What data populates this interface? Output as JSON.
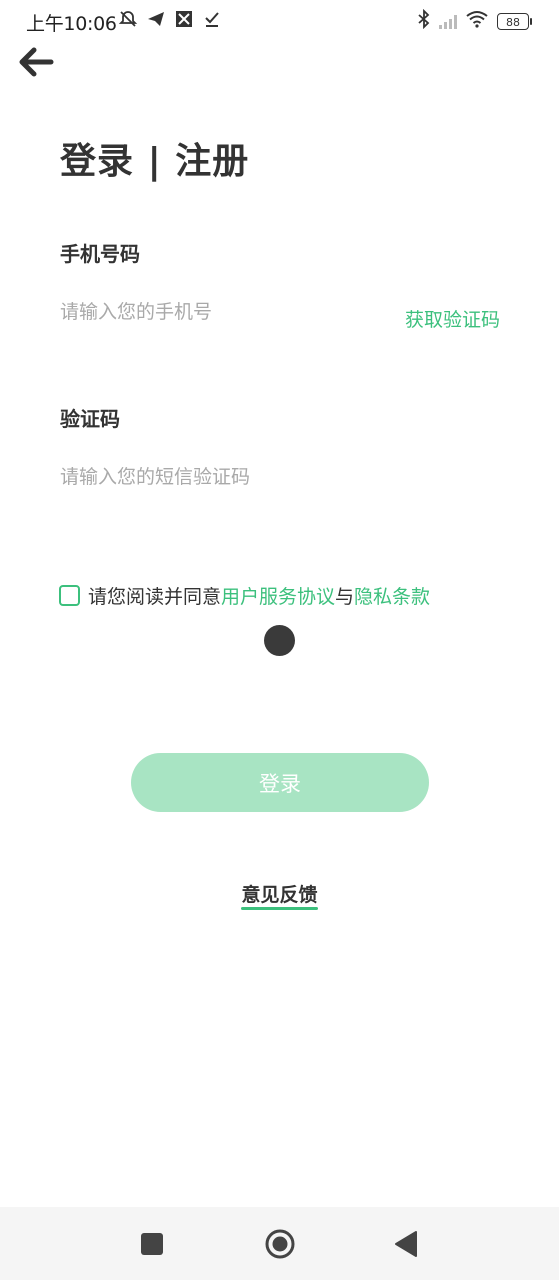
{
  "status_bar": {
    "time": "上午10:06",
    "battery": "88"
  },
  "title": {
    "login": "登录",
    "separator": "|",
    "register": "注册"
  },
  "phone": {
    "label": "手机号码",
    "placeholder": "请输入您的手机号",
    "get_code_label": "获取验证码"
  },
  "code": {
    "label": "验证码",
    "placeholder": "请输入您的短信验证码"
  },
  "agreement": {
    "prefix": "请您阅读并同意",
    "terms_link": "用户服务协议",
    "connector": "与",
    "privacy_link": "隐私条款"
  },
  "login_button": "登录",
  "feedback": "意见反馈",
  "colors": {
    "accent": "#3cc07d",
    "button_disabled": "#a8e4c3"
  },
  "icons": {
    "back": "arrow-left-icon",
    "nav_recent": "square-icon",
    "nav_home": "circle-icon",
    "nav_back": "triangle-icon"
  }
}
